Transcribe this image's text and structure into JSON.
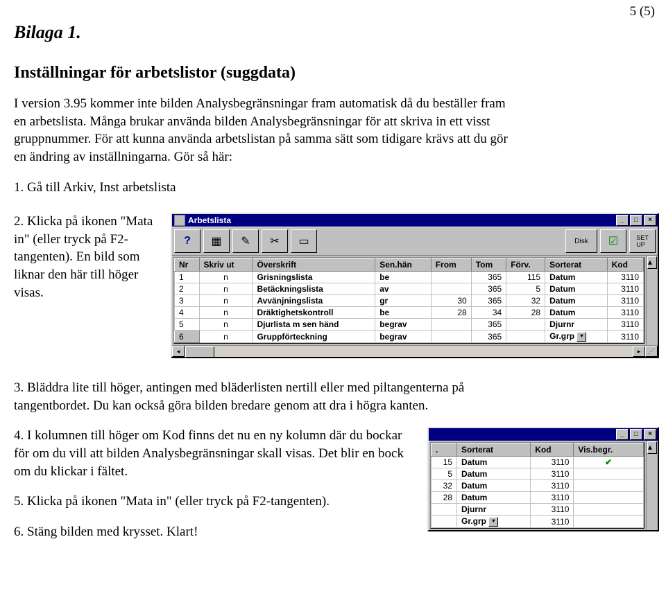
{
  "page_num": "5 (5)",
  "bilaga": "Bilaga 1.",
  "heading": "Inställningar för arbetslistor (suggdata)",
  "intro": "I version 3.95 kommer inte bilden Analysbegränsningar fram automatisk då du beställer fram en arbetslista. Många brukar använda bilden Analysbegränsningar för att skriva in ett visst gruppnummer. För att kunna använda arbetslistan på samma sätt som tidigare krävs att du gör en ändring av inställningarna. Gör så här:",
  "step1": "1. Gå till Arkiv, Inst arbetslista",
  "step2": "2. Klicka på ikonen \"Mata in\" (eller tryck på F2-tangenten). En bild som liknar den här till höger visas.",
  "step3": "3. Bläddra lite till höger, antingen med bläderlisten nertill eller med piltangenterna på tangentbordet. Du kan också göra bilden bredare genom att dra i högra kanten.",
  "step4": "4. I kolumnen till höger om Kod finns det nu en ny kolumn där du bockar för om du vill att bilden Analysbegränsningar skall visas. Det blir en bock om du klickar i fältet.",
  "step5": "5. Klicka på ikonen \"Mata in\" (eller tryck på F2-tangenten).",
  "step6": "6. Stäng bilden med krysset. Klart!",
  "win1": {
    "title": "Arbetslista",
    "toolbar_icons": [
      "question-icon",
      "new-icon",
      "edit-icon",
      "paint-icon",
      "disk-icon",
      "setup-icon"
    ],
    "columns": [
      "Nr",
      "Skriv ut",
      "Överskrift",
      "Sen.hän",
      "From",
      "Tom",
      "Förv.",
      "Sorterat",
      "Kod"
    ],
    "rows": [
      {
        "nr": "1",
        "skriv": "n",
        "over": "Grisningslista",
        "sen": "be",
        "from": "",
        "tom": "365",
        "forv": "115",
        "sort": "Datum",
        "kod": "3110"
      },
      {
        "nr": "2",
        "skriv": "n",
        "over": "Betäckningslista",
        "sen": "av",
        "from": "",
        "tom": "365",
        "forv": "5",
        "sort": "Datum",
        "kod": "3110"
      },
      {
        "nr": "3",
        "skriv": "n",
        "over": "Avvänjningslista",
        "sen": "gr",
        "from": "30",
        "tom": "365",
        "forv": "32",
        "sort": "Datum",
        "kod": "3110"
      },
      {
        "nr": "4",
        "skriv": "n",
        "over": "Dräktighetskontroll",
        "sen": "be",
        "from": "28",
        "tom": "34",
        "forv": "28",
        "sort": "Datum",
        "kod": "3110"
      },
      {
        "nr": "5",
        "skriv": "n",
        "over": "Djurlista m sen händ",
        "sen": "begrav",
        "from": "",
        "tom": "365",
        "forv": "",
        "sort": "Djurnr",
        "kod": "3110"
      },
      {
        "nr": "6",
        "skriv": "n",
        "over": "Gruppförteckning",
        "sen": "begrav",
        "from": "",
        "tom": "365",
        "forv": "",
        "sort": "Gr.grp",
        "kod": "3110"
      }
    ]
  },
  "win2": {
    "columns": [
      ".",
      "Sorterat",
      "Kod",
      "Vis.begr."
    ],
    "rows": [
      {
        "c0": "15",
        "sort": "Datum",
        "kod": "3110",
        "vis": "✔"
      },
      {
        "c0": "5",
        "sort": "Datum",
        "kod": "3110",
        "vis": ""
      },
      {
        "c0": "32",
        "sort": "Datum",
        "kod": "3110",
        "vis": ""
      },
      {
        "c0": "28",
        "sort": "Datum",
        "kod": "3110",
        "vis": ""
      },
      {
        "c0": "",
        "sort": "Djurnr",
        "kod": "3110",
        "vis": ""
      },
      {
        "c0": "",
        "sort": "Gr.grp",
        "kod": "3110",
        "vis": ""
      }
    ]
  }
}
